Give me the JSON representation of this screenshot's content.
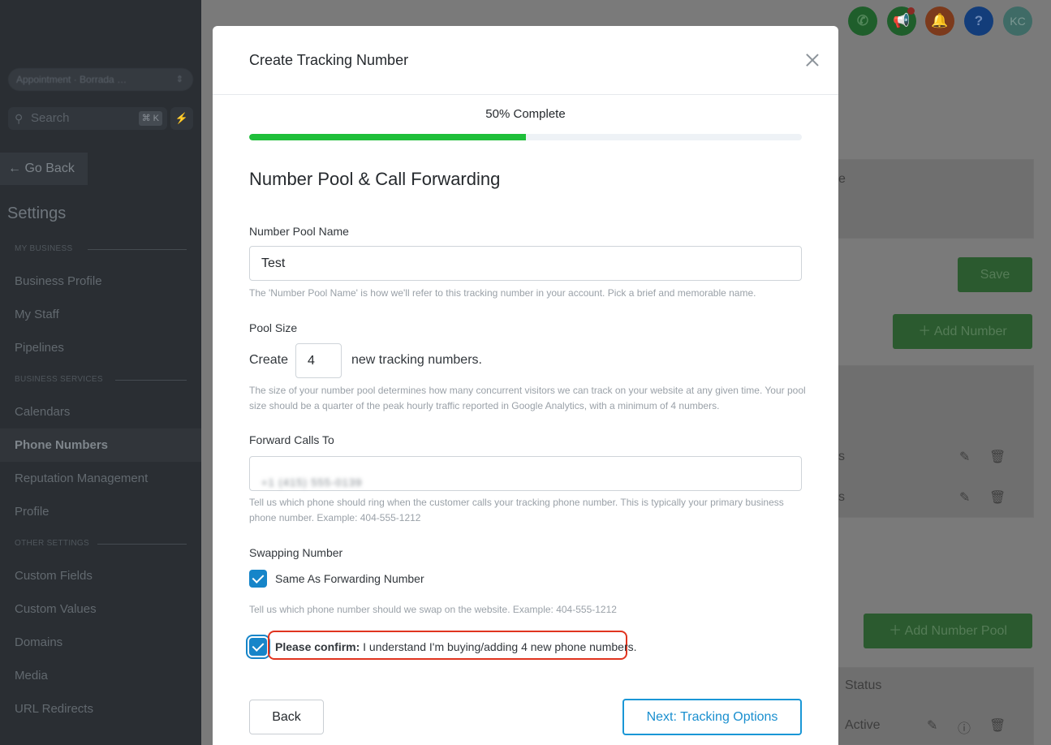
{
  "sidebar": {
    "account_name": "Appointment · Borrada …",
    "search": {
      "placeholder": "Search",
      "shortcut": "⌘ K"
    },
    "go_back": "Go Back",
    "title": "Settings",
    "sections": [
      {
        "heading": "MY BUSINESS",
        "items": [
          "Business Profile",
          "My Staff",
          "Pipelines"
        ]
      },
      {
        "heading": "BUSINESS SERVICES",
        "items": [
          "Calendars",
          "Phone Numbers",
          "Reputation Management",
          "Profile"
        ]
      },
      {
        "heading": "OTHER SETTINGS",
        "items": [
          "Custom Fields",
          "Custom Values",
          "Domains",
          "Media",
          "URL Redirects"
        ]
      }
    ],
    "active_item": "Phone Numbers"
  },
  "topbar": {
    "avatar_initials": "KC",
    "help_glyph": "?"
  },
  "background": {
    "save_label": "Save",
    "add_number_label": "Add Number",
    "add_number_pool_label": "Add Number Pool",
    "status_header": "Status",
    "status_value": "Active",
    "fragment_e": "e",
    "fragment_s1": "s",
    "fragment_s2": "s"
  },
  "modal": {
    "title": "Create Tracking Number",
    "progress": {
      "label": "50% Complete",
      "percent": 50
    },
    "section_title": "Number Pool & Call Forwarding",
    "pool_name": {
      "label": "Number Pool Name",
      "value": "Test",
      "help": "The 'Number Pool Name' is how we'll refer to this tracking number in your account. Pick a brief and memorable name."
    },
    "pool_size": {
      "label": "Pool Size",
      "prefix": "Create",
      "value": "4",
      "suffix": "new tracking numbers.",
      "help": "The size of your number pool determines how many concurrent visitors we can track on your website at any given time. Your pool size should be a quarter of the peak hourly traffic reported in Google Analytics, with a minimum of 4 numbers."
    },
    "forward_calls": {
      "label": "Forward Calls To",
      "value": "+1 (415) 555-0139",
      "help": "Tell us which phone should ring when the customer calls your tracking phone number. This is typically your primary business phone number. Example: 404-555-1212"
    },
    "swapping": {
      "label": "Swapping Number",
      "checkbox_label": "Same As Forwarding Number",
      "checked": true,
      "help": "Tell us which phone number should we swap on the website. Example: 404-555-1212"
    },
    "confirm": {
      "bold": "Please confirm:",
      "text": " I understand I'm buying/adding 4 new phone numbers.",
      "checked": true
    },
    "back_label": "Back",
    "next_label": "Next: Tracking Options"
  }
}
